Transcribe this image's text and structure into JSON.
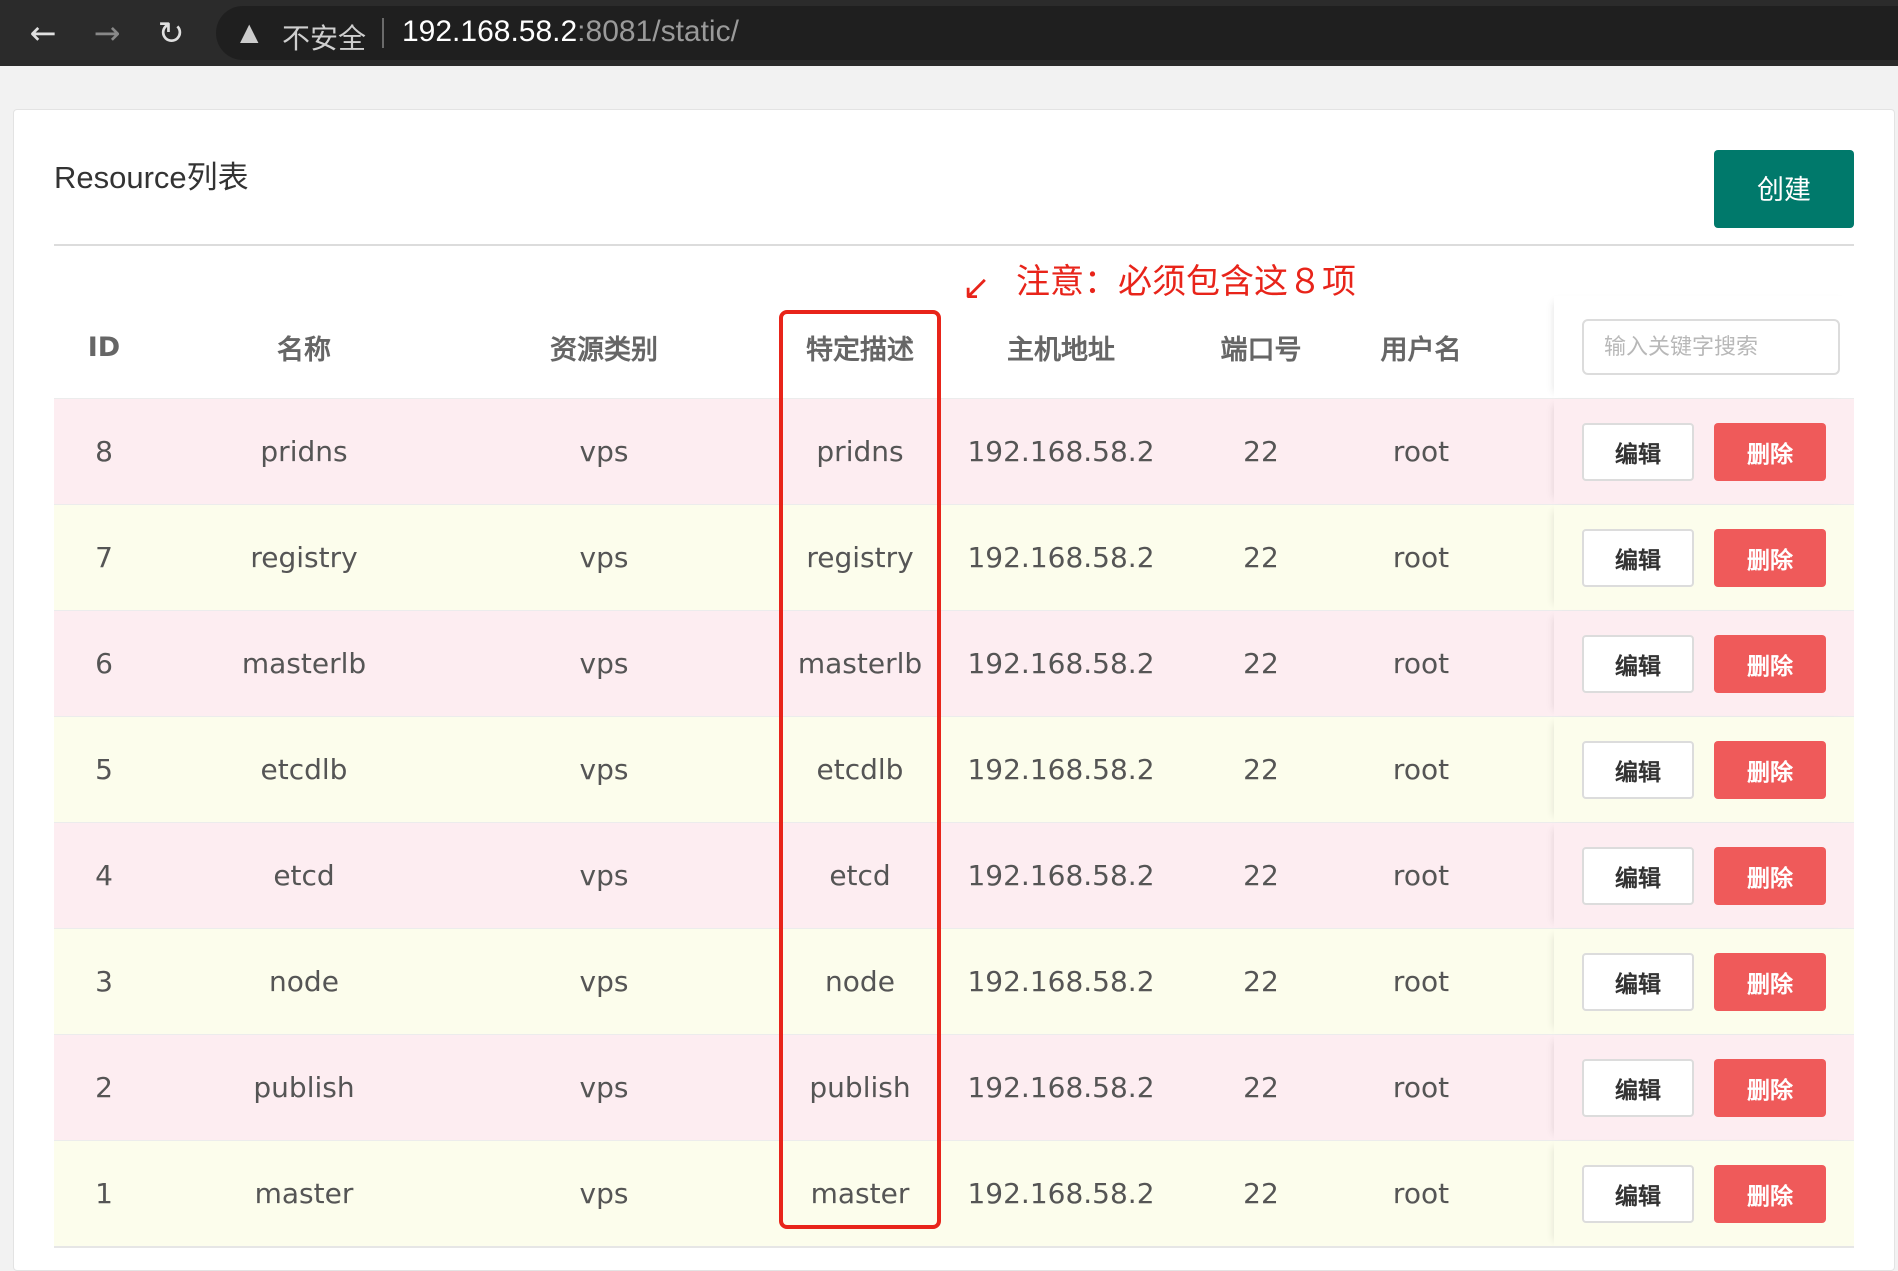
{
  "browser": {
    "back_icon": "←",
    "forward_icon": "→",
    "reload_icon": "↻",
    "warning_icon": "▲",
    "insecure_label": "不安全",
    "url_host": "192.168.58.2",
    "url_rest": ":8081/static/"
  },
  "page": {
    "title": "Resource列表",
    "create_label": "创建"
  },
  "annotation": {
    "arrow": "↙",
    "text": "注意：必须包含这８项",
    "color": "#e8241a"
  },
  "table": {
    "headers": {
      "id": "ID",
      "name": "名称",
      "type": "资源类别",
      "desc": "特定描述",
      "host": "主机地址",
      "port": "端口号",
      "user": "用户名"
    },
    "search_placeholder": "输入关键字搜索",
    "edit_label": "编辑",
    "delete_label": "删除",
    "rows": [
      {
        "id": "8",
        "name": "pridns",
        "type": "vps",
        "desc": "pridns",
        "host": "192.168.58.2",
        "port": "22",
        "user": "root"
      },
      {
        "id": "7",
        "name": "registry",
        "type": "vps",
        "desc": "registry",
        "host": "192.168.58.2",
        "port": "22",
        "user": "root"
      },
      {
        "id": "6",
        "name": "masterlb",
        "type": "vps",
        "desc": "masterlb",
        "host": "192.168.58.2",
        "port": "22",
        "user": "root"
      },
      {
        "id": "5",
        "name": "etcdlb",
        "type": "vps",
        "desc": "etcdlb",
        "host": "192.168.58.2",
        "port": "22",
        "user": "root"
      },
      {
        "id": "4",
        "name": "etcd",
        "type": "vps",
        "desc": "etcd",
        "host": "192.168.58.2",
        "port": "22",
        "user": "root"
      },
      {
        "id": "3",
        "name": "node",
        "type": "vps",
        "desc": "node",
        "host": "192.168.58.2",
        "port": "22",
        "user": "root"
      },
      {
        "id": "2",
        "name": "publish",
        "type": "vps",
        "desc": "publish",
        "host": "192.168.58.2",
        "port": "22",
        "user": "root"
      },
      {
        "id": "1",
        "name": "master",
        "type": "vps",
        "desc": "master",
        "host": "192.168.58.2",
        "port": "22",
        "user": "root"
      }
    ]
  },
  "colors": {
    "primary": "#00796b",
    "danger": "#ef5a5a",
    "row_pink": "#fdedf1",
    "row_cream": "#fcfdec"
  }
}
